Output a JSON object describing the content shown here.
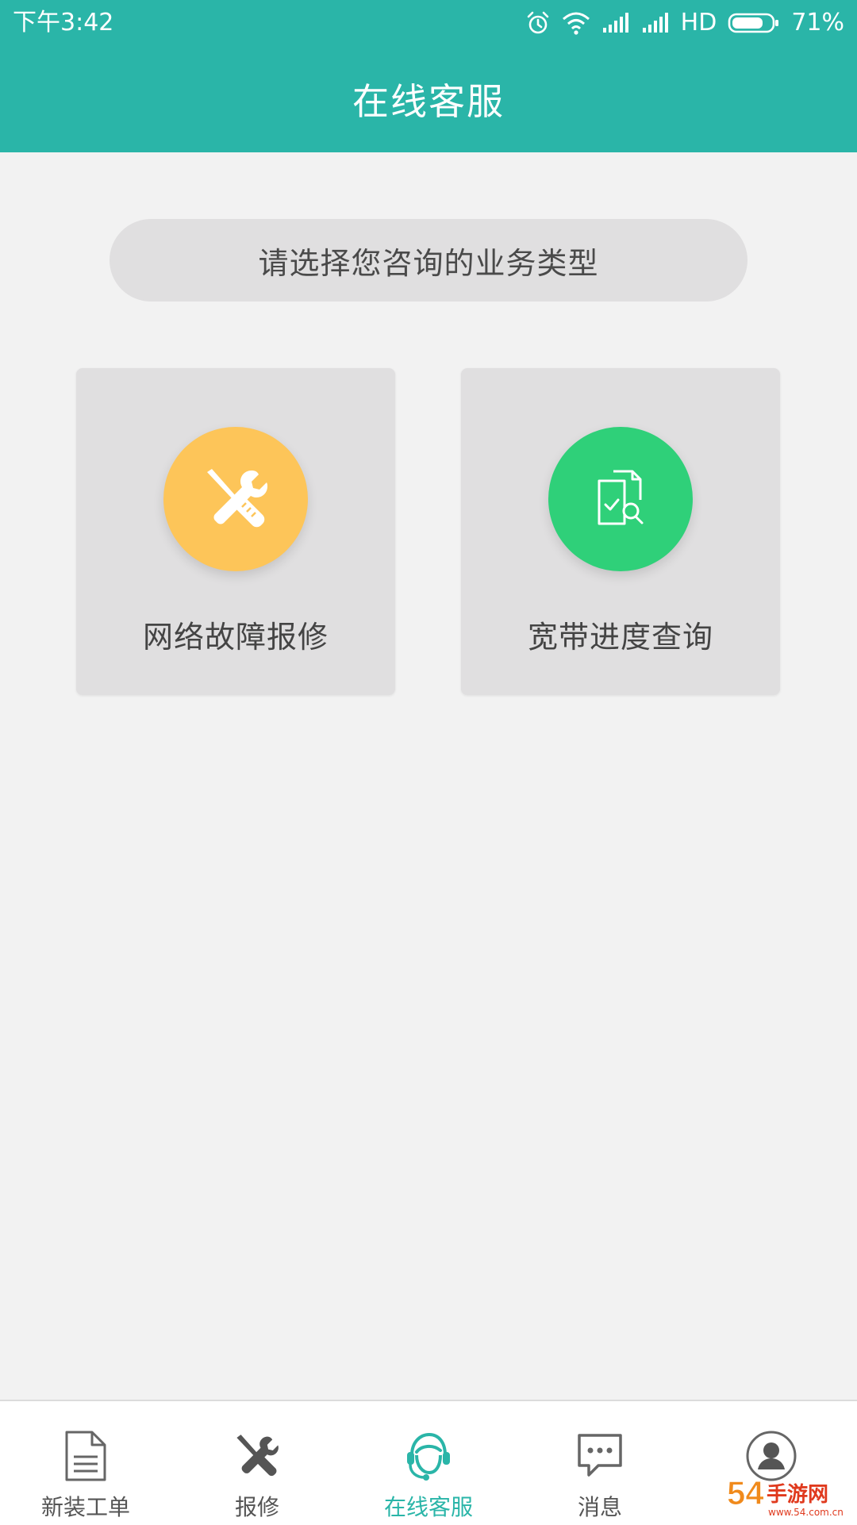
{
  "status_bar": {
    "time": "下午3:42",
    "network_type": "HD",
    "battery": "71%",
    "icons": [
      "alarm-icon",
      "wifi-icon",
      "signal-icon",
      "signal-icon",
      "battery-icon"
    ]
  },
  "header": {
    "title": "在线客服"
  },
  "prompt": {
    "text": "请选择您咨询的业务类型"
  },
  "cards": [
    {
      "label": "网络故障报修",
      "icon": "wrench-screwdriver-icon",
      "color": "#fdc559"
    },
    {
      "label": "宽带进度查询",
      "icon": "document-search-icon",
      "color": "#2fd079"
    }
  ],
  "bottom_nav": {
    "items": [
      {
        "label": "新装工单",
        "icon": "document-icon"
      },
      {
        "label": "报修",
        "icon": "tools-icon"
      },
      {
        "label": "在线客服",
        "icon": "customer-service-icon",
        "active": true
      },
      {
        "label": "消息",
        "icon": "chat-bubble-icon"
      },
      {
        "label": "",
        "icon": "user-avatar-icon"
      }
    ]
  },
  "watermark": {
    "text": "54:手游网",
    "subtext": "www.54.com.cn"
  },
  "colors": {
    "primary": "#2ab5a8",
    "background": "#f2f2f2",
    "card": "#e0dfe0",
    "repair_circle": "#fdc559",
    "query_circle": "#2fd079",
    "nav_inactive": "#555555"
  }
}
